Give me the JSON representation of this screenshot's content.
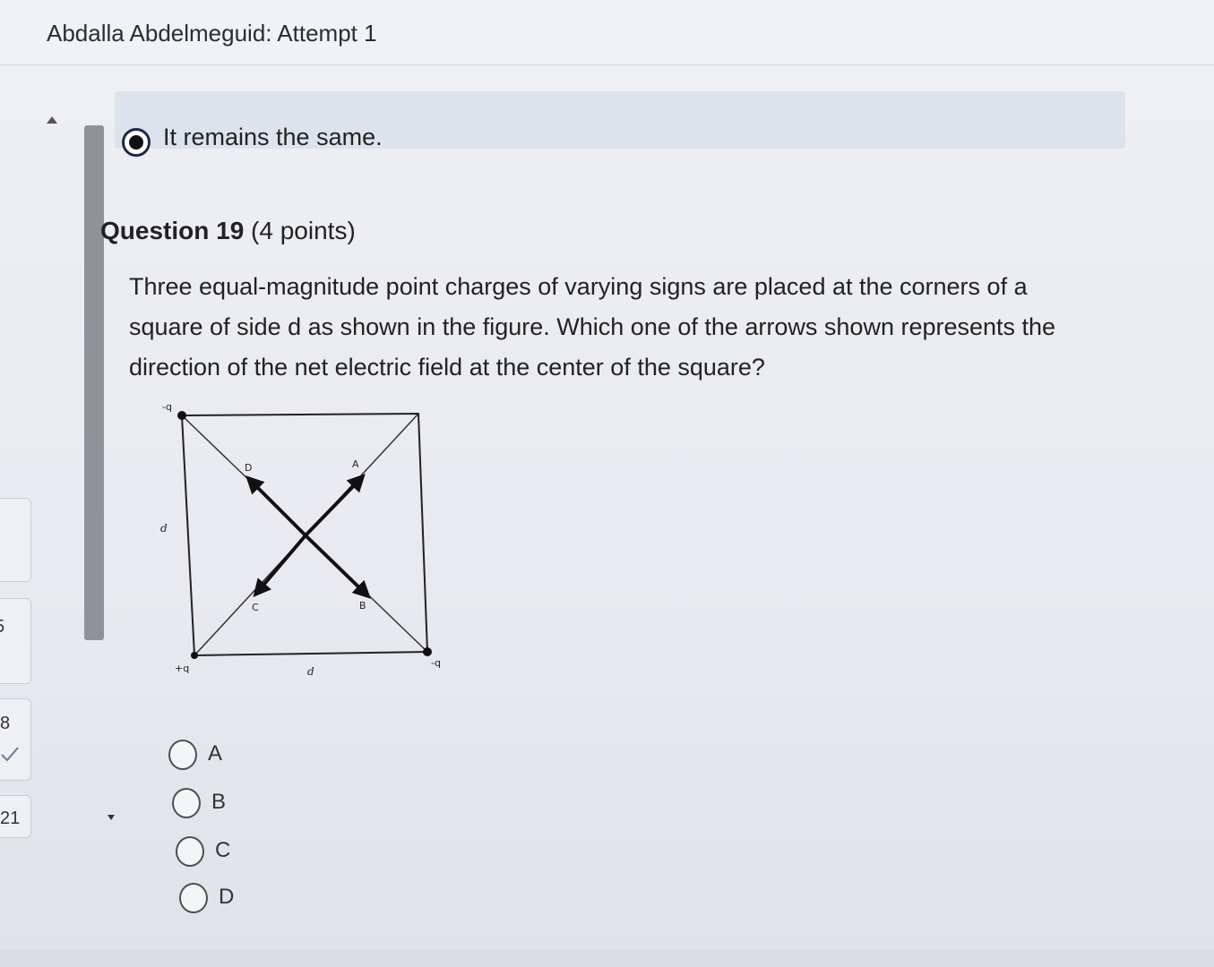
{
  "header": {
    "title": "Abdalla Abdelmeguid: Attempt 1"
  },
  "sidebar": {
    "numbers": [
      "8",
      "21"
    ],
    "partial_number": "5"
  },
  "previous_question": {
    "selected_answer": "It remains the same."
  },
  "question": {
    "title": "Question 19",
    "points": "(4 points)",
    "text": "Three equal-magnitude point charges of varying signs are placed at the corners of a square of side d as shown in the figure. Which one of the arrows shown represents the direction of the net electric field at the center of the square?"
  },
  "figure": {
    "charges": {
      "top_left": "-q",
      "bottom_left": "+q",
      "bottom_right": "-q"
    },
    "side_labels": {
      "left": "d",
      "bottom": "d"
    },
    "arrows": {
      "top_left": "D",
      "top_right": "A",
      "bottom_left": "C",
      "bottom_right": "B"
    }
  },
  "options": [
    "A",
    "B",
    "C",
    "D"
  ]
}
